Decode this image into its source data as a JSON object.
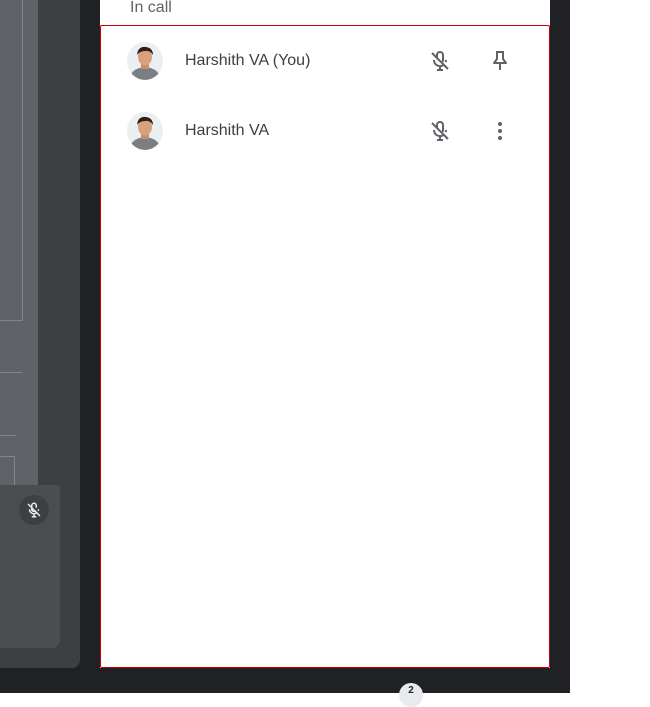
{
  "people_panel": {
    "section_title": "In call",
    "participants": [
      {
        "name": "Harshith VA (You)",
        "mic_icon": "mic-off-icon",
        "action_icon": "pin-icon"
      },
      {
        "name": "Harshith VA",
        "mic_icon": "mic-off-icon",
        "action_icon": "more-vert-icon"
      }
    ]
  },
  "bottom_bar": {
    "participant_count": "2"
  },
  "colors": {
    "highlight_border": "#cc0000",
    "dark_background": "#202124",
    "icon_gray": "#5f6368"
  }
}
